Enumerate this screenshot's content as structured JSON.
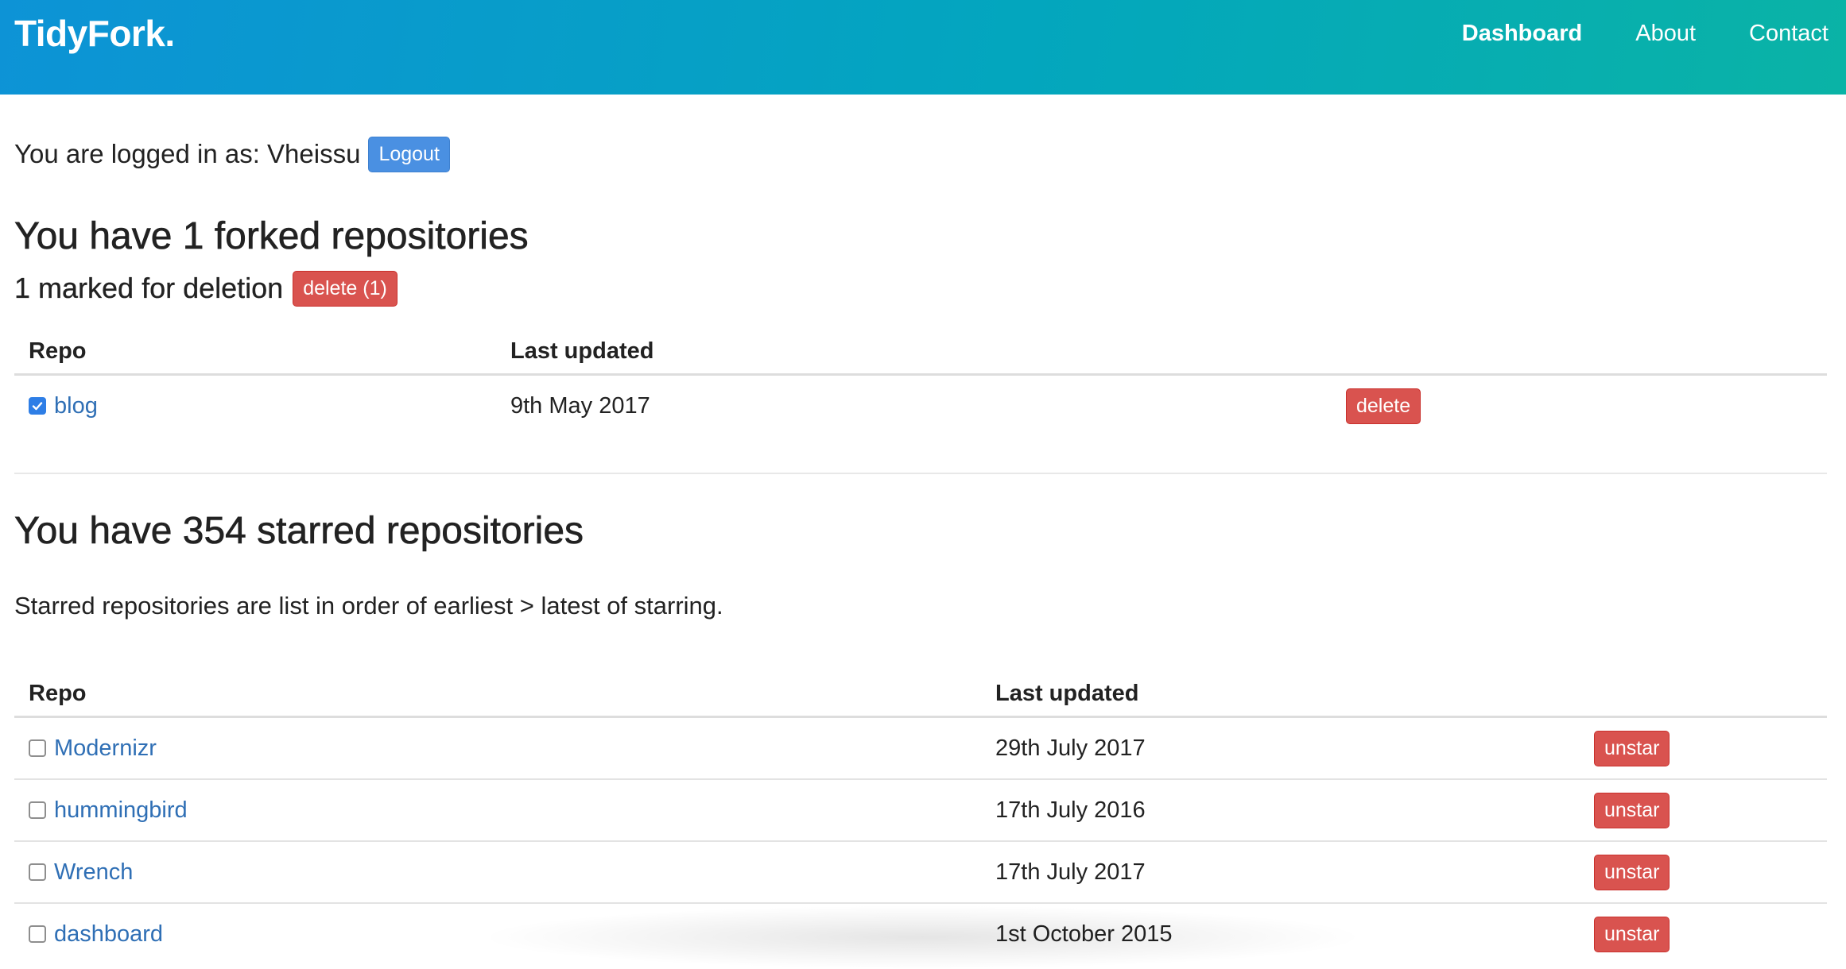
{
  "header": {
    "brand": "TidyFork.",
    "nav": [
      {
        "label": "Dashboard",
        "active": true
      },
      {
        "label": "About",
        "active": false
      },
      {
        "label": "Contact",
        "active": false
      }
    ]
  },
  "session": {
    "logged_in_text": "You are logged in as: Vheissu",
    "logout_label": "Logout"
  },
  "forked": {
    "title": "You have 1 forked repositories",
    "marked_text": "1 marked for deletion",
    "bulk_delete_label": "delete (1)",
    "columns": [
      "Repo",
      "Last updated"
    ],
    "rows": [
      {
        "name": "blog",
        "updated": "9th May 2017",
        "checked": true,
        "action": "delete"
      }
    ]
  },
  "starred": {
    "title": "You have 354 starred repositories",
    "info": "Starred repositories are list in order of earliest > latest of starring.",
    "columns": [
      "Repo",
      "Last updated"
    ],
    "rows": [
      {
        "name": "Modernizr",
        "updated": "29th July 2017",
        "checked": false,
        "action": "unstar"
      },
      {
        "name": "hummingbird",
        "updated": "17th July 2016",
        "checked": false,
        "action": "unstar"
      },
      {
        "name": "Wrench",
        "updated": "17th July 2017",
        "checked": false,
        "action": "unstar"
      },
      {
        "name": "dashboard",
        "updated": "1st October 2015",
        "checked": false,
        "action": "unstar"
      }
    ]
  },
  "colors": {
    "header_gradient_start": "#0d93d6",
    "header_gradient_end": "#0ab3a6",
    "primary": "#4a90e2",
    "danger": "#d9534f",
    "link": "#2f6fb5"
  }
}
